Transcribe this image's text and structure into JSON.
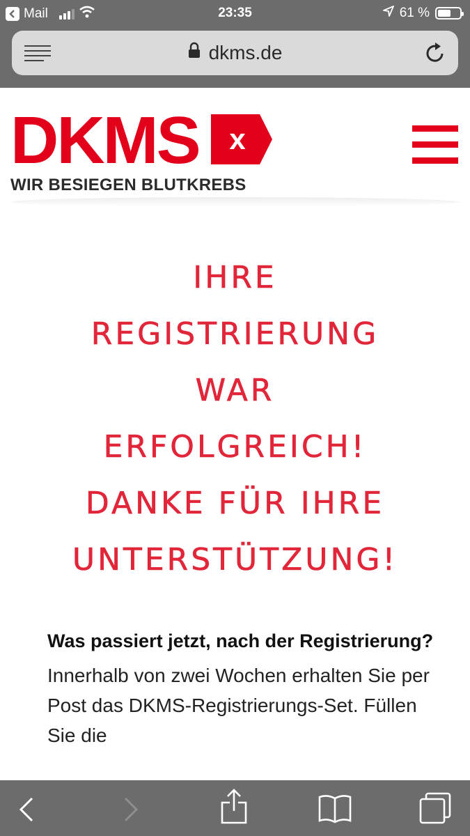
{
  "status_bar": {
    "back_app": "Mail",
    "time": "23:35",
    "battery": "61 %",
    "battery_level": 0.61
  },
  "browser": {
    "url": "dkms.de"
  },
  "header": {
    "logo_text": "DKMS",
    "logo_badge": "x",
    "tagline": "WIR BESIEGEN BLUTKREBS"
  },
  "headline": {
    "lines": [
      "IHRE",
      "REGISTRIERUNG",
      "WAR",
      "ERFOLGREICH!",
      "DANKE FÜR IHRE",
      "UNTERSTÜTZUNG!"
    ]
  },
  "content": {
    "heading": "Was passiert jetzt, nach der Registrierung?",
    "paragraph": "Innerhalb von zwei Wochen erhalten Sie per Post das DKMS-Registrierungs-Set. Füllen Sie die"
  },
  "colors": {
    "brand_red": "#e2001a",
    "chrome_gray": "#6c6c6c"
  }
}
